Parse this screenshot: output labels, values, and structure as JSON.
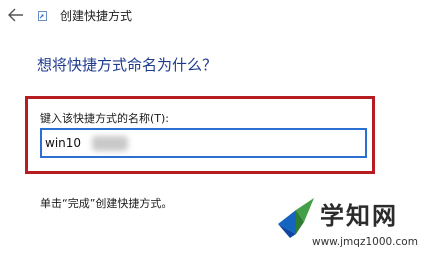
{
  "window": {
    "title": "创建快捷方式",
    "back_icon": "arrow-left-icon",
    "app_icon": "shortcut-file-icon"
  },
  "main": {
    "heading": "想将快捷方式命名为什么？",
    "field_label": "键入该快捷方式的名称(T):",
    "name_value": "win10",
    "finish_hint": "单击“完成”创建快捷方式。"
  },
  "annotation": {
    "highlight_color": "#b71c23"
  },
  "colors": {
    "heading": "#1f3b8f",
    "input_border": "#2a6fd1"
  },
  "watermark": {
    "name": "学知网",
    "url": "www.jmqz1000.com",
    "logo_icon": "xuezhi-logo-icon"
  }
}
